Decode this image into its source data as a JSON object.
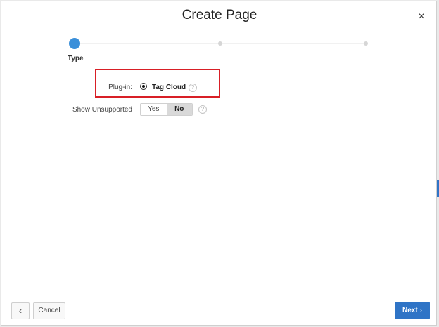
{
  "dialog": {
    "title": "Create Page",
    "close_icon": "close-icon",
    "close_glyph": "×"
  },
  "wizard": {
    "active_step_label": "Type",
    "step_count": 3,
    "active_step": 1,
    "active_color": "#3a8fd9"
  },
  "form": {
    "plugin_label": "Plug-in:",
    "plugin_option": "Tag Cloud",
    "plugin_selected": true,
    "show_unsupported_label": "Show Unsupported",
    "toggle_yes": "Yes",
    "toggle_no": "No",
    "toggle_selected": "No",
    "help_glyph": "?"
  },
  "footer": {
    "back_glyph": "‹",
    "cancel_label": "Cancel",
    "next_label": "Next",
    "next_glyph": "›",
    "next_color": "#2f74c6"
  },
  "highlight_color": "#d81f26"
}
